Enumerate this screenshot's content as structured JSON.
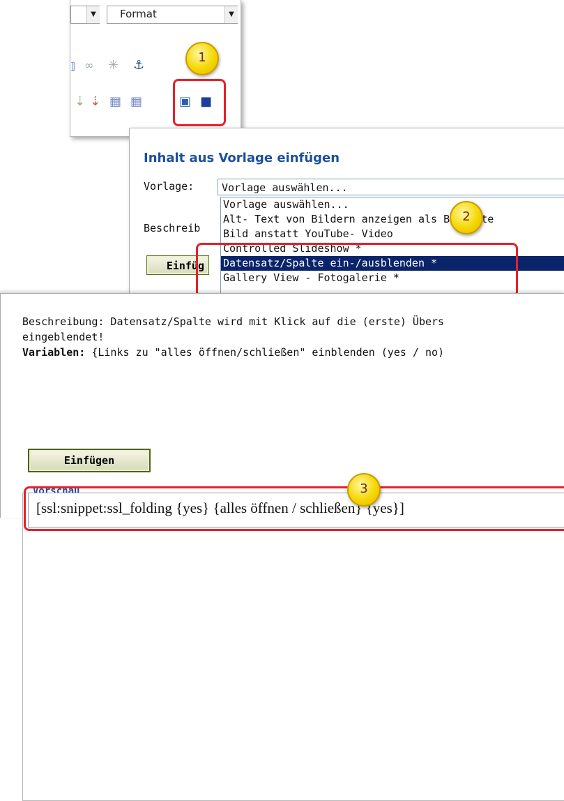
{
  "toolbar": {
    "format_combo": "Format",
    "first_combo": ""
  },
  "dialog": {
    "title": "Inhalt aus Vorlage einfügen",
    "vorlage_label": "Vorlage:",
    "vorlage_value": "Vorlage auswählen...",
    "beschreibung_label": "Beschreib",
    "einfuegen_label": "Einfüg",
    "dropdown_items": [
      "Vorlage auswählen...",
      "Alt- Text von Bildern anzeigen als Bildunte",
      "Bild anstatt YouTube- Video",
      "Controlled Slideshow *",
      "Datensatz/Spalte ein-/ausblenden *",
      "Gallery View - Fotogalerie *"
    ]
  },
  "preview_panel": {
    "beschreibung_line1": "Beschreibung: Datensatz/Spalte wird mit Klick auf die (erste) Übers",
    "beschreibung_line2": "eingeblendet!",
    "variablen_label": "Variablen:",
    "variablen_text": " {Links zu \"alles öffnen/schließen\" einblenden (yes / no)",
    "einfuegen_button": "Einfügen",
    "vorschau_legend": "Vorschau",
    "snippet": "[ssl:snippet:ssl_folding {yes} {alles öffnen / schließen} {yes}]"
  },
  "callouts": [
    "1",
    "2",
    "3"
  ],
  "colors": {
    "accent_blue": "#1b4f9c",
    "highlight_red": "#e5212b",
    "badge_yellow": "#f4d800",
    "selection_navy": "#0a246a"
  }
}
